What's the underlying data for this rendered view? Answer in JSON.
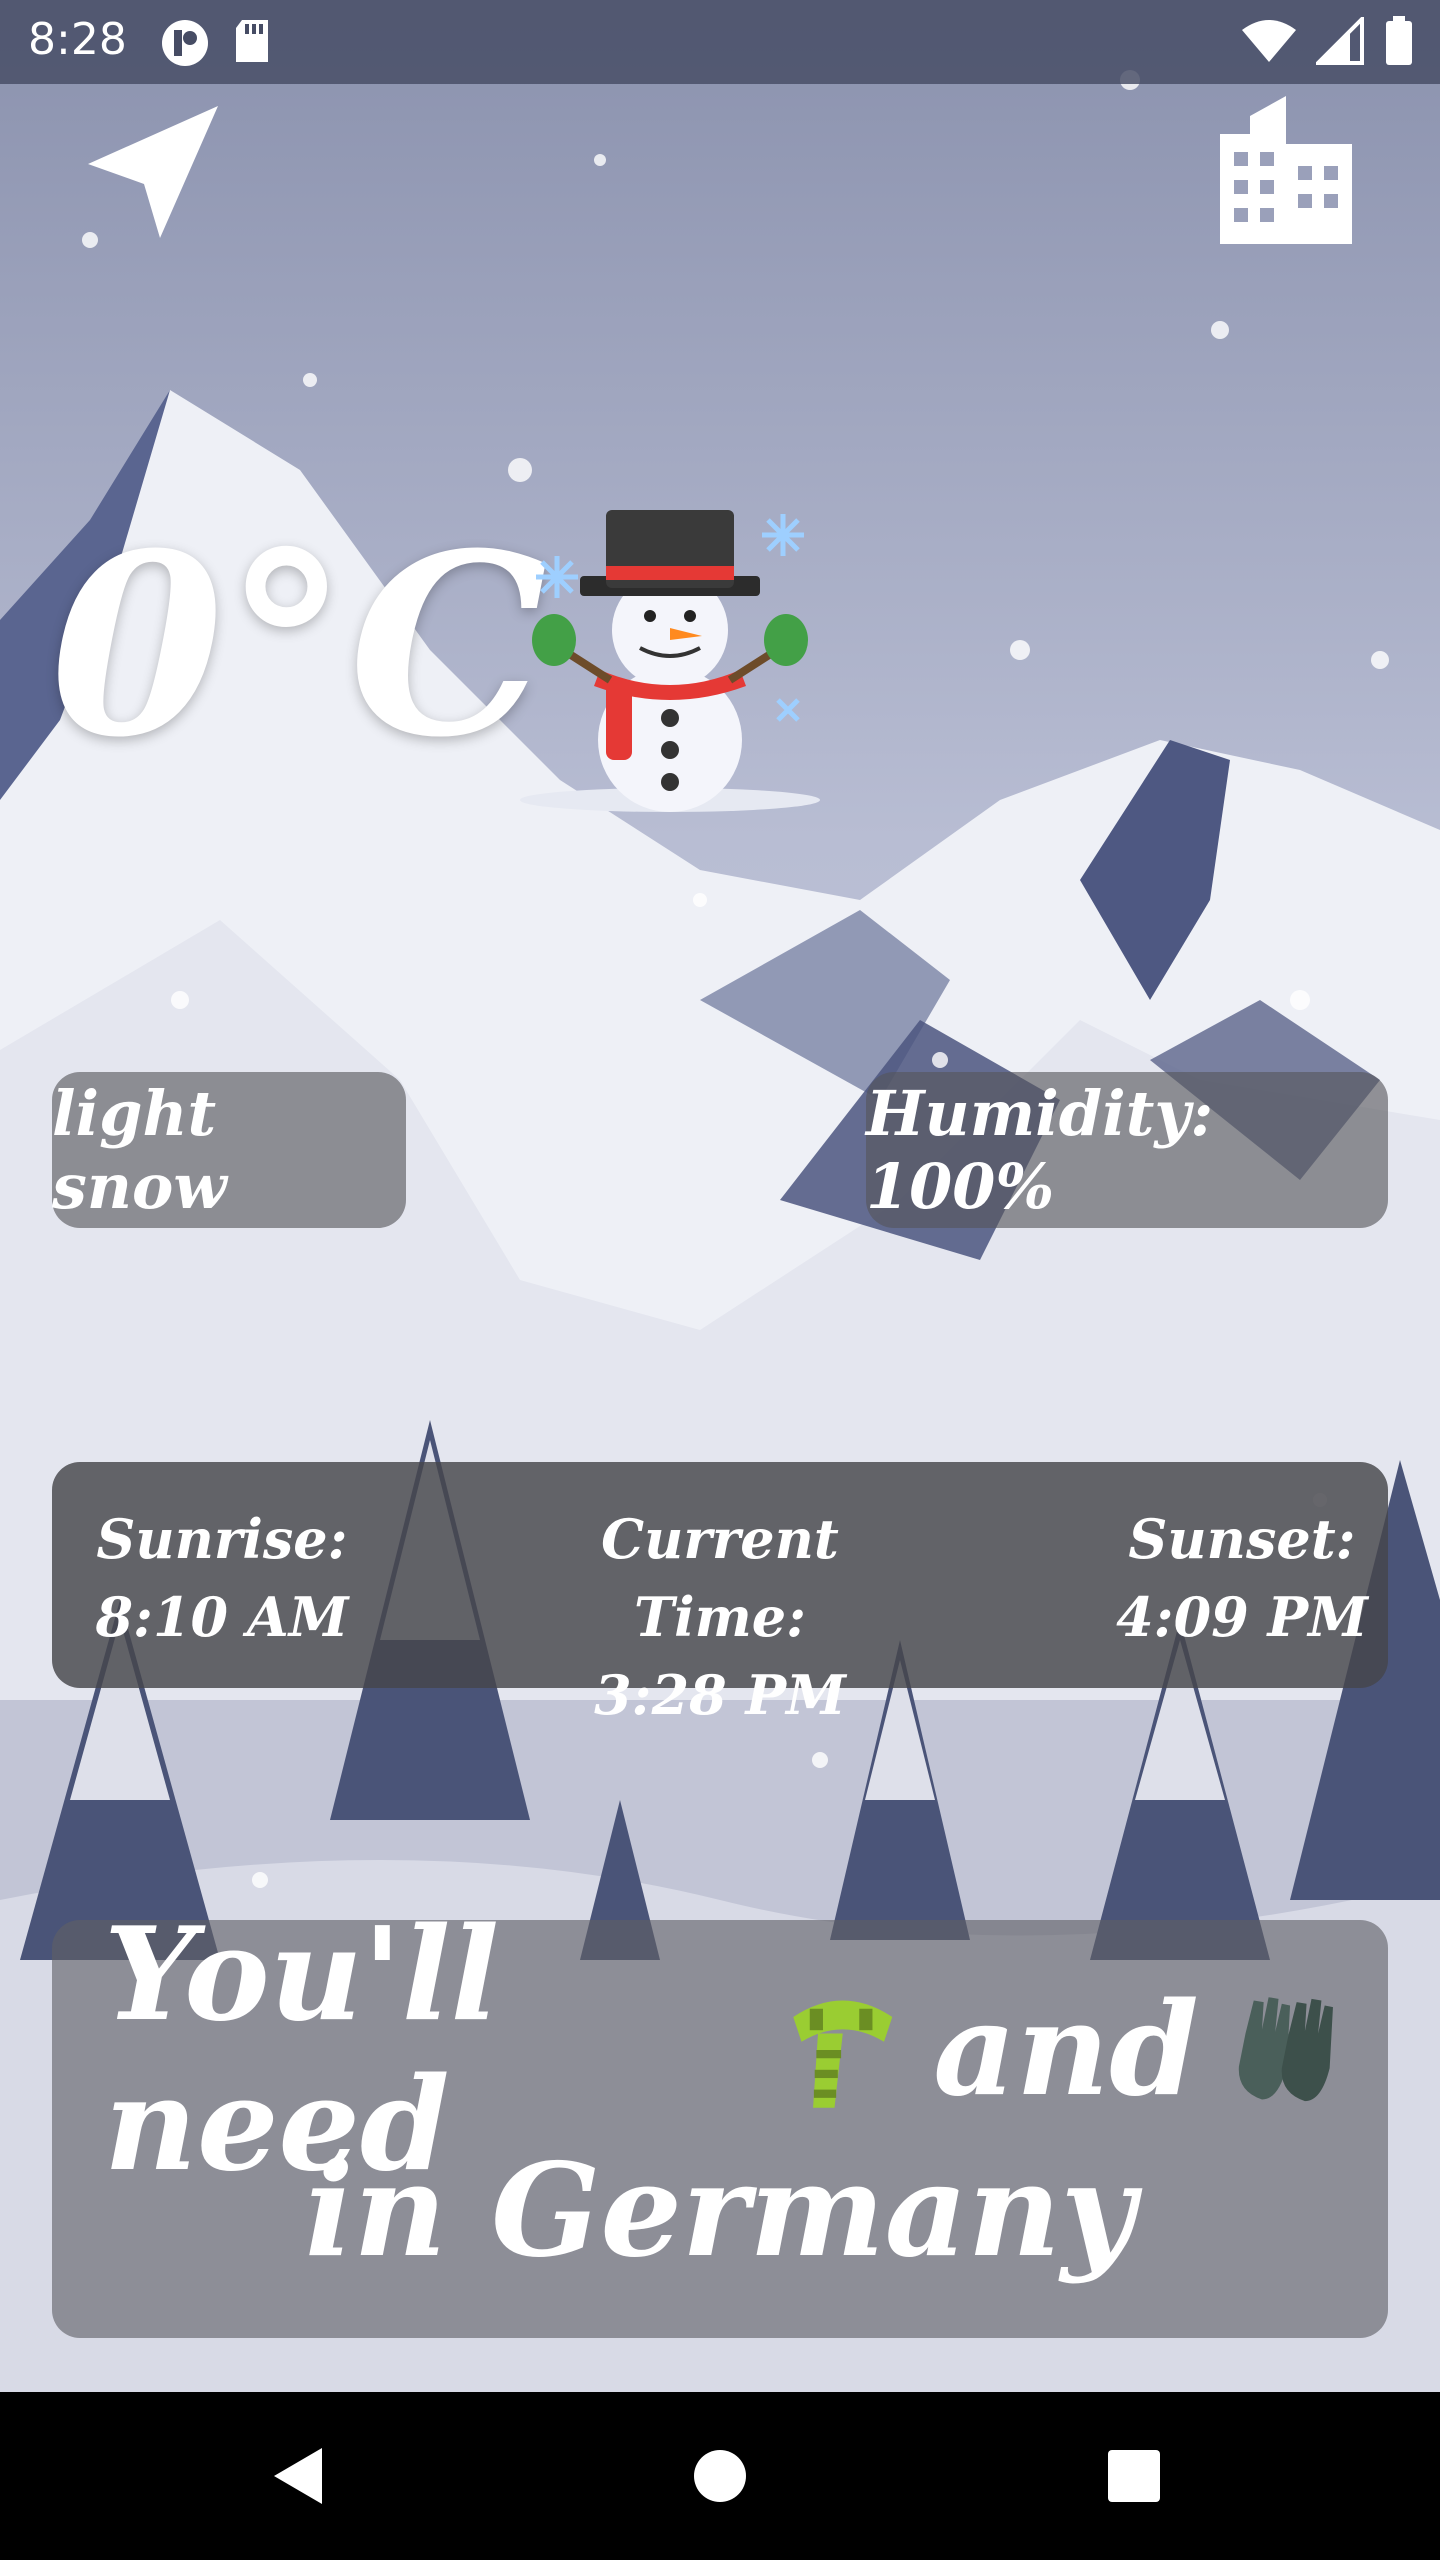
{
  "status_bar": {
    "time": "8:28",
    "icons": [
      "app-notification-icon",
      "sd-card-icon",
      "wifi-icon",
      "signal-icon",
      "battery-icon"
    ]
  },
  "top_actions": {
    "location_icon": "navigation-arrow-icon",
    "city_icon": "city-building-icon"
  },
  "weather": {
    "temperature": "0°C",
    "condition_emoji": "snowman-icon",
    "condition": "light snow",
    "humidity": "Humidity: 100%"
  },
  "times": {
    "sunrise_label": "Sunrise:",
    "sunrise_value": "8:10 AM",
    "current_label": "Current Time:",
    "current_value": "3:28 PM",
    "sunset_label": "Sunset:",
    "sunset_value": "4:09 PM"
  },
  "advice": {
    "prefix": "You'll need",
    "item1_icon": "scarf-icon",
    "conjunction": "and",
    "item2_icon": "gloves-icon",
    "suffix": "in Germany"
  },
  "nav_bar": {
    "icons": [
      "back-icon",
      "home-icon",
      "recents-icon"
    ]
  },
  "colors": {
    "status_bar": "#464c64",
    "card_dark": "#46464b",
    "text": "#ffffff"
  }
}
